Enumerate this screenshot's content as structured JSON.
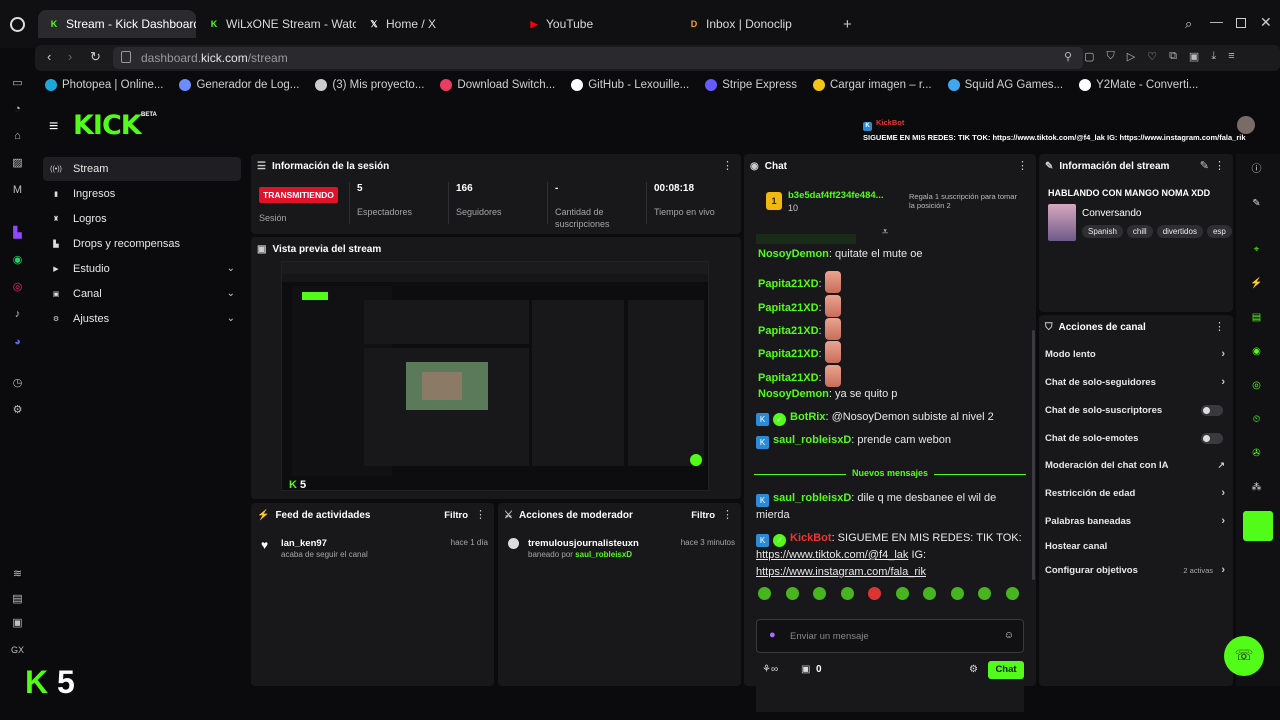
{
  "browser": {
    "tabs": [
      {
        "label": "Stream - Kick Dashboard",
        "fav_color": "#53fc18",
        "fav_char": "K"
      },
      {
        "label": "WiLxONE Stream - Watch",
        "fav_color": "#53fc18",
        "fav_char": "K"
      },
      {
        "label": "Home / X",
        "fav_color": "#ffffff",
        "fav_char": "𝕏"
      },
      {
        "label": "YouTube",
        "fav_color": "#ff0000",
        "fav_char": "▶"
      },
      {
        "label": "Inbox | Donoclip",
        "fav_color": "#f1a226",
        "fav_char": "D"
      }
    ],
    "url_prefix": "dashboard.",
    "url_domain": "kick.com",
    "url_path": "/stream",
    "bookmarks": [
      {
        "label": "Photopea | Online...",
        "color": "#1fa6d9"
      },
      {
        "label": "Generador de Log...",
        "color": "#6c8cff"
      },
      {
        "label": "(3)  Mis proyecto...",
        "color": "#cccccc"
      },
      {
        "label": "Download Switch...",
        "color": "#e83d62"
      },
      {
        "label": "GitHub - Lexouille...",
        "color": "#ffffff"
      },
      {
        "label": "Stripe Express",
        "color": "#635bff"
      },
      {
        "label": "Cargar imagen – r...",
        "color": "#f5c518"
      },
      {
        "label": "Squid AG Games...",
        "color": "#3fa6f0"
      },
      {
        "label": "Y2Mate - Converti...",
        "color": "#ffffff"
      }
    ]
  },
  "kick": {
    "logo": "KICK",
    "logo_badge": "BETA",
    "ticker_bot": "KickBot",
    "ticker_text": "SIGUEME EN MIS REDES: TIK TOK: https://www.tiktok.com/@f4_lak IG: https://www.instagram.com/fala_rik",
    "nav": [
      {
        "label": "Stream",
        "icon": "broadcast-icon",
        "glyph": "((•))"
      },
      {
        "label": "Ingresos",
        "icon": "money-icon",
        "glyph": "▮"
      },
      {
        "label": "Logros",
        "icon": "trophy-icon",
        "glyph": "♜"
      },
      {
        "label": "Drops y recompensas",
        "icon": "gift-icon",
        "glyph": "▙"
      },
      {
        "label": "Estudio",
        "icon": "studio-icon",
        "glyph": "▶"
      },
      {
        "label": "Canal",
        "icon": "channel-icon",
        "glyph": "▣"
      },
      {
        "label": "Ajustes",
        "icon": "gear-icon",
        "glyph": "⚙"
      }
    ],
    "session": {
      "title": "Información de la sesión",
      "live_badge": "TRANSMITIENDO",
      "session_label": "Sesión",
      "stats": [
        {
          "value": "5",
          "label": "Espectadores"
        },
        {
          "value": "166",
          "label": "Seguidores"
        },
        {
          "value": "-",
          "label": "Cantidad de suscripciones"
        },
        {
          "value": "00:08:18",
          "label": "Tiempo en vivo"
        }
      ]
    },
    "preview": {
      "title": "Vista previa del stream",
      "viewers": "5"
    },
    "feed": {
      "title": "Feed de actividades",
      "filter": "Filtro",
      "item_user": "lan_ken97",
      "item_text": "acaba de seguir el canal",
      "item_time": "hace 1 día"
    },
    "mod": {
      "title": "Acciones de moderador",
      "filter": "Filtro",
      "item_user": "tremulousjournalisteuxn",
      "item_text_prefix": "baneado por",
      "item_by": "saul_robleisxD",
      "item_time": "hace 3 minutos"
    },
    "chat": {
      "title": "Chat",
      "top_user": "b3e5daf4ff234fe484...",
      "top_count": "10",
      "gift_text": "Regala 1 suscripción para tomar la posición 2",
      "messages": [
        {
          "user": "NosoyDemon",
          "text": ": quitate el mute oe",
          "badge": false,
          "emote": false
        },
        {
          "user": "Papita21XD",
          "text": ":",
          "badge": false,
          "emote": true
        },
        {
          "user": "Papita21XD",
          "text": ":",
          "badge": false,
          "emote": true
        },
        {
          "user": "Papita21XD",
          "text": ":",
          "badge": false,
          "emote": true
        },
        {
          "user": "Papita21XD",
          "text": ":",
          "badge": false,
          "emote": true
        },
        {
          "user": "Papita21XD",
          "text": ":",
          "badge": false,
          "emote": true
        },
        {
          "user": "NosoyDemon",
          "text": ": ya se quito p",
          "badge": false,
          "emote": false
        },
        {
          "user": "BotRix",
          "text": ": @NosoyDemon subiste al nivel 2",
          "badge": true,
          "emote": false
        },
        {
          "user": "saul_robleisxD",
          "text": ": prende cam webon",
          "badge": true,
          "emote": false
        }
      ],
      "new_messages": "Nuevos mensajes",
      "msg_after_user": "saul_robleisxD",
      "msg_after_text": ": dile q me desbanee el wil de mierda",
      "bot_user": "KickBot",
      "bot_text": ": SIGUEME EN MIS REDES: TIK TOK:",
      "bot_link1": "https://www.tiktok.com/@f4_lak",
      "bot_ig": " IG:",
      "bot_link2": "https://www.instagram.com/fala_rik",
      "input_placeholder": "Enviar un mensaje",
      "points": "0",
      "send": "Chat"
    },
    "stream_info": {
      "title": "Información del stream",
      "stream_title": "HABLANDO CON MANGO NOMA XDD",
      "category": "Conversando",
      "tags": [
        "Spanish",
        "chill",
        "divertidos",
        "esp"
      ]
    },
    "channel_actions": {
      "title": "Acciones de canal",
      "items": [
        {
          "label": "Modo lento",
          "kind": "chevron"
        },
        {
          "label": "Chat de solo-seguidores",
          "kind": "chevron"
        },
        {
          "label": "Chat de solo-suscriptores",
          "kind": "toggle"
        },
        {
          "label": "Chat de solo-emotes",
          "kind": "toggle"
        },
        {
          "label": "Moderación del chat con IA",
          "kind": "external"
        },
        {
          "label": "Restricción de edad",
          "kind": "chevron"
        },
        {
          "label": "Palabras baneadas",
          "kind": "chevron"
        },
        {
          "label": "Hostear canal",
          "kind": "none"
        },
        {
          "label": "Configurar objetivos",
          "kind": "chevron"
        }
      ],
      "objectives_status": "2 activas"
    },
    "overlay_count": "5",
    "accent": "#53fc18"
  }
}
